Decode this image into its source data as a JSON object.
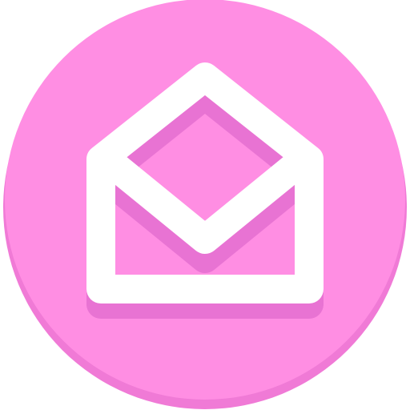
{
  "icon": {
    "name": "open-envelope-icon",
    "colors": {
      "circle_base": "#ff8ee3",
      "circle_shade": "#f07ad6",
      "envelope_shadow": "#e873d3",
      "envelope_outline": "#ffffff"
    }
  }
}
